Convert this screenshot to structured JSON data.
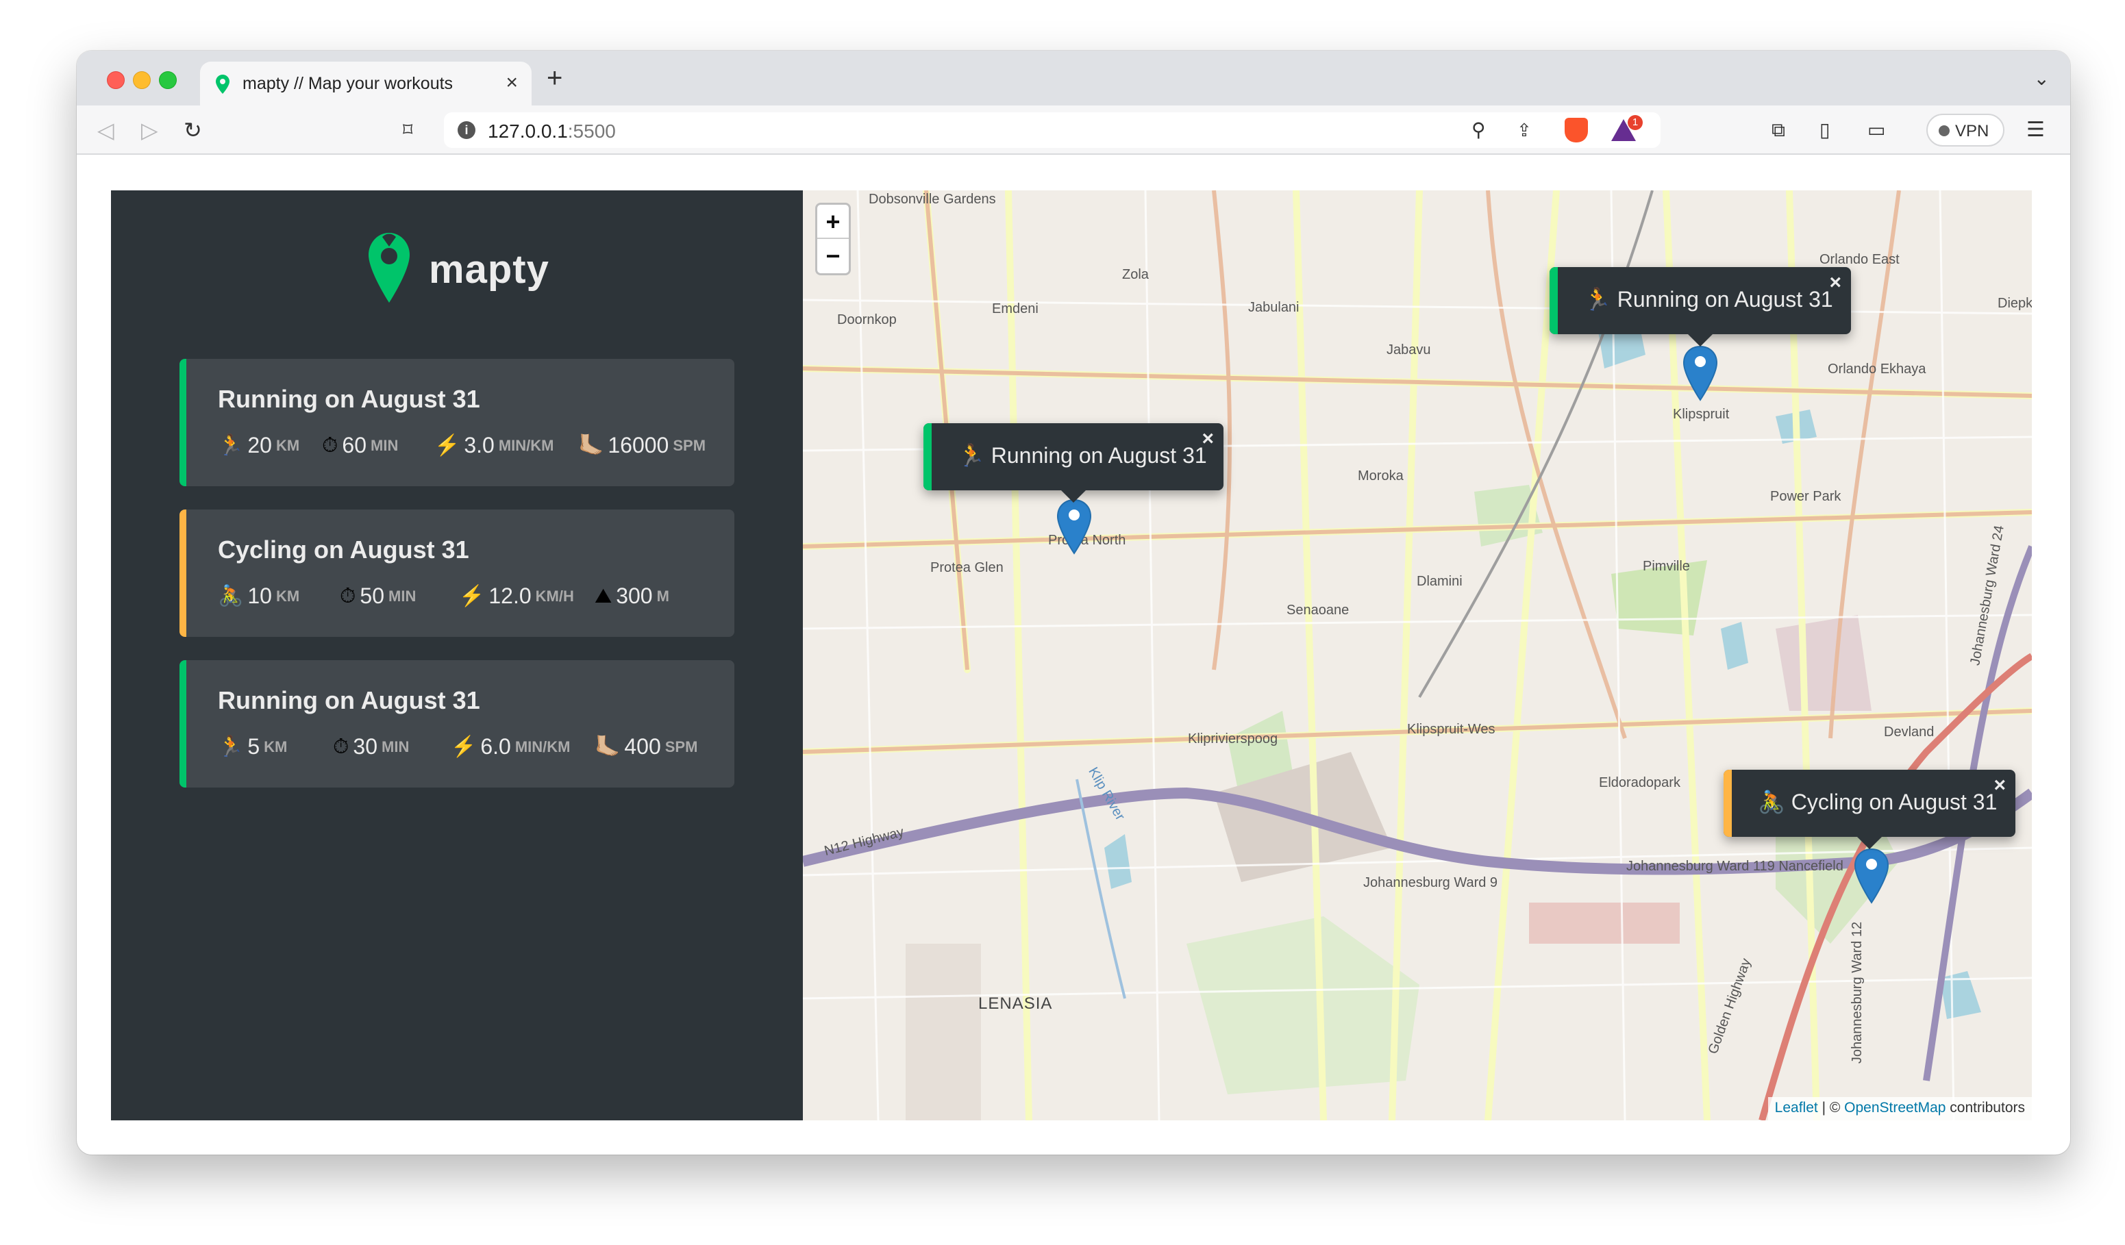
{
  "browser": {
    "tab_title": "mapty // Map your workouts",
    "tab_close": "×",
    "new_tab": "+",
    "url_host": "127.0.0.1",
    "url_port": ":5500",
    "vpn_label": "VPN",
    "alert_count": "1"
  },
  "app": {
    "logo_text": "mapty",
    "colors": {
      "running": "#00c46a",
      "cycling": "#ffb545",
      "sidebar_bg": "#2d3439",
      "card_bg": "#42484d"
    }
  },
  "workouts": [
    {
      "title": "Running on August 31",
      "type": "running",
      "details": [
        {
          "icon": "🏃",
          "value": "20",
          "unit": "km"
        },
        {
          "icon": "⏱",
          "value": "60",
          "unit": "min"
        },
        {
          "icon": "⚡️",
          "value": "3.0",
          "unit": "min/km"
        },
        {
          "icon": "🦶🏼",
          "value": "16000",
          "unit": "spm"
        }
      ]
    },
    {
      "title": "Cycling on August 31",
      "type": "cycling",
      "details": [
        {
          "icon": "🚴",
          "value": "10",
          "unit": "km"
        },
        {
          "icon": "⏱",
          "value": "50",
          "unit": "min"
        },
        {
          "icon": "⚡️",
          "value": "12.0",
          "unit": "km/h"
        },
        {
          "icon": "⛰",
          "value": "300",
          "unit": "m"
        }
      ]
    },
    {
      "title": "Running on August 31",
      "type": "running",
      "details": [
        {
          "icon": "🏃",
          "value": "5",
          "unit": "km"
        },
        {
          "icon": "⏱",
          "value": "30",
          "unit": "min"
        },
        {
          "icon": "⚡️",
          "value": "6.0",
          "unit": "min/km"
        },
        {
          "icon": "🦶🏼",
          "value": "400",
          "unit": "spm"
        }
      ]
    }
  ],
  "map": {
    "zoom_in": "+",
    "zoom_out": "−",
    "popups": [
      {
        "text": "🏃 Running on August 31",
        "type": "running"
      },
      {
        "text": "🏃 Running on August 31",
        "type": "running"
      },
      {
        "text": "🚴 Cycling on August 31",
        "type": "cycling"
      }
    ],
    "popup_close": "×",
    "place_labels": [
      "Dobsonville Gardens",
      "Zola",
      "Emdeni",
      "Doornkop",
      "Jabulani",
      "Jabavu",
      "Orlando East",
      "Orlando Ekhaya",
      "Klipspruit",
      "Moroka",
      "Power Park",
      "Protea North",
      "Protea Glen",
      "Dlamini",
      "Pimville",
      "Senaoane",
      "Kliprivierspoog",
      "Klipspruit-Wes",
      "Devland",
      "Eldoradopark",
      "Johannesburg Ward 9",
      "Johannesburg Ward 119 Nancefield",
      "LENASIA",
      "N12 Highway",
      "Golden Highway",
      "Klip River",
      "Diepk",
      "Johannesburg Ward 24",
      "Johannesburg Ward 12"
    ],
    "attribution": {
      "leaflet": "Leaflet",
      "separator": " | © ",
      "osm": "OpenStreetMap",
      "suffix": " contributors"
    }
  }
}
